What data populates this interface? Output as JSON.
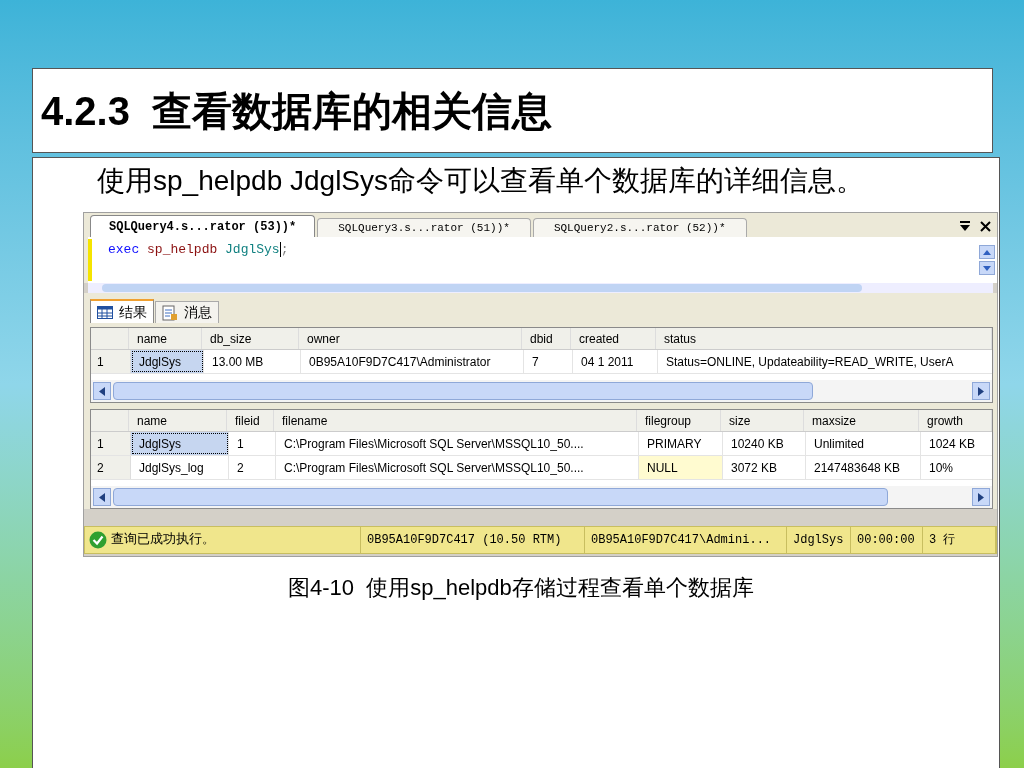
{
  "title": "4.2.3  查看数据库的相关信息",
  "intro": "使用sp_helpdb JdglSys命令可以查看单个数据库的详细信息。",
  "query_tabs": [
    {
      "label": "SQLQuery4.s...rator (53))*",
      "selected": true
    },
    {
      "label": "SQLQuery3.s...rator (51))*",
      "selected": false
    },
    {
      "label": "SQLQuery2.s...rator (52))*",
      "selected": false
    }
  ],
  "editor": {
    "tokens": [
      {
        "text": "exec",
        "kind": "keyword"
      },
      {
        "text": "sp_helpdb",
        "kind": "procedure"
      },
      {
        "text": "JdglSys",
        "kind": "identifier"
      },
      {
        "text": ";",
        "kind": "punctuation"
      }
    ]
  },
  "result_tabs": [
    {
      "label": "结果",
      "kind": "grid",
      "selected": true
    },
    {
      "label": "消息",
      "kind": "messages",
      "selected": false
    }
  ],
  "grids": [
    {
      "columns": [
        "name",
        "db_size",
        "owner",
        "dbid",
        "created",
        "status"
      ],
      "rows": [
        {
          "number": "1",
          "selected": true,
          "cells": [
            {
              "text": "JdglSys",
              "null": false
            },
            {
              "text": "13.00 MB",
              "null": false
            },
            {
              "text": "0B95A10F9D7C417\\Administrator",
              "null": false
            },
            {
              "text": "7",
              "null": false
            },
            {
              "text": "04  1 2011",
              "null": false
            },
            {
              "text": "Status=ONLINE, Updateability=READ_WRITE, UserA",
              "null": false
            }
          ]
        }
      ]
    },
    {
      "columns": [
        "name",
        "fileid",
        "filename",
        "filegroup",
        "size",
        "maxsize",
        "growth"
      ],
      "rows": [
        {
          "number": "1",
          "selected": true,
          "cells": [
            {
              "text": "JdglSys",
              "null": false
            },
            {
              "text": "1",
              "null": false
            },
            {
              "text": "C:\\Program Files\\Microsoft SQL Server\\MSSQL10_50....",
              "null": false
            },
            {
              "text": "PRIMARY",
              "null": false
            },
            {
              "text": "10240 KB",
              "null": false
            },
            {
              "text": "Unlimited",
              "null": false
            },
            {
              "text": "1024 KB",
              "null": false
            }
          ]
        },
        {
          "number": "2",
          "selected": false,
          "cells": [
            {
              "text": "JdglSys_log",
              "null": false
            },
            {
              "text": "2",
              "null": false
            },
            {
              "text": "C:\\Program Files\\Microsoft SQL Server\\MSSQL10_50....",
              "null": false
            },
            {
              "text": "NULL",
              "null": true
            },
            {
              "text": "3072 KB",
              "null": false
            },
            {
              "text": "2147483648 KB",
              "null": false
            },
            {
              "text": "10%",
              "null": false
            }
          ]
        }
      ]
    }
  ],
  "status_bar": {
    "message": "查询已成功执行。",
    "server": "0B95A10F9D7C417 (10.50 RTM)",
    "user": "0B95A10F9D7C417\\Admini...",
    "database": "JdglSys",
    "time": "00:00:00",
    "rows": "3 行"
  },
  "caption": "图4-10  使用sp_helpdb存储过程查看单个数据库"
}
